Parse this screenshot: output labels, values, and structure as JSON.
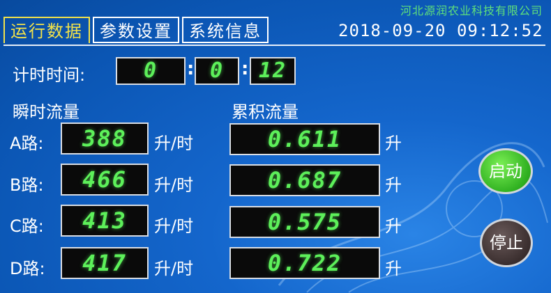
{
  "company": "河北源润农业科技有限公司",
  "tabs": [
    {
      "label": "运行数据",
      "active": true
    },
    {
      "label": "参数设置",
      "active": false
    },
    {
      "label": "系统信息",
      "active": false
    }
  ],
  "datetime": "2018-09-20 09:12:52",
  "timer": {
    "label": "计时时间:",
    "hours": "0",
    "minutes": "0",
    "seconds": "12"
  },
  "headers": {
    "instant": "瞬时流量",
    "cumulative": "累积流量"
  },
  "rows": [
    {
      "label": "A路:",
      "instant": "388",
      "instant_unit": "升/时",
      "cumulative": "0.611",
      "cumulative_unit": "升"
    },
    {
      "label": "B路:",
      "instant": "466",
      "instant_unit": "升/时",
      "cumulative": "0.687",
      "cumulative_unit": "升"
    },
    {
      "label": "C路:",
      "instant": "413",
      "instant_unit": "升/时",
      "cumulative": "0.575",
      "cumulative_unit": "升"
    },
    {
      "label": "D路:",
      "instant": "417",
      "instant_unit": "升/时",
      "cumulative": "0.722",
      "cumulative_unit": "升"
    }
  ],
  "buttons": {
    "start": "启动",
    "stop": "停止"
  },
  "colors": {
    "display_digits": "#5df05a",
    "active_tab": "#f2e24a",
    "company": "#5fe07a",
    "start_button": "#2fb020"
  }
}
